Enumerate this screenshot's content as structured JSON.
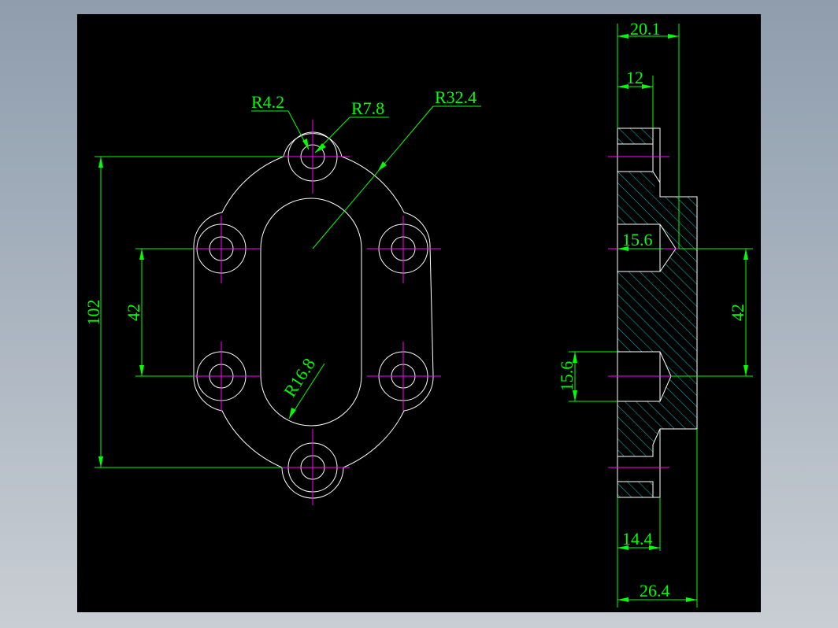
{
  "drawing": {
    "background": "#000000",
    "outline_color": "#ffffff",
    "centerline_color": "#ff00ff",
    "dimension_color": "#00ff00",
    "hatch_color": "#00c8c8"
  },
  "front_view": {
    "radius_labels": {
      "bolt_hole": "R4.2",
      "boss": "R7.8",
      "outer": "R32.4",
      "slot": "R16.8"
    },
    "dimensions": {
      "overall_height": "102",
      "hole_spacing": "42"
    }
  },
  "side_view": {
    "dimensions": {
      "top_width": "20.1",
      "counterbore_depth": "12",
      "upper_hole_diameter": "15.6",
      "lower_hole_diameter": "15.6",
      "hole_spacing": "42",
      "bottom_counterbore": "14.4",
      "overall_width": "26.4"
    }
  }
}
